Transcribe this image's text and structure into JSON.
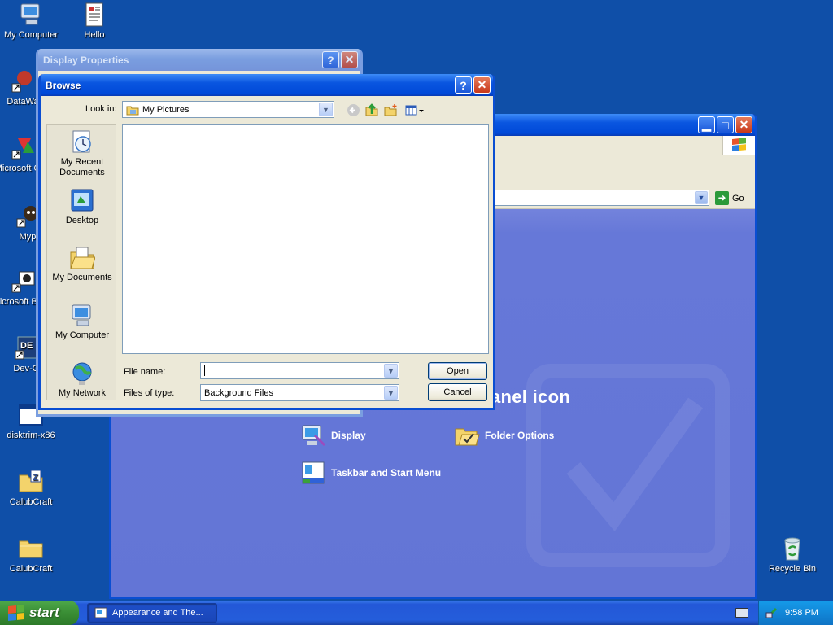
{
  "desktop": {
    "icons": [
      {
        "label": "My Computer",
        "icon": "computer-icon"
      },
      {
        "label": "Hello",
        "icon": "document-icon"
      },
      {
        "label": "DataWa",
        "icon": "shortcut-icon"
      },
      {
        "label": "Microsoft C++",
        "icon": "shortcut-icon"
      },
      {
        "label": "Myp",
        "icon": "shortcut-icon"
      },
      {
        "label": "Microsoft Basic",
        "icon": "shortcut-icon"
      },
      {
        "label": "Dev-C",
        "icon": "shortcut-icon"
      },
      {
        "label": "disktrim-x86",
        "icon": "app-icon"
      },
      {
        "label": "CalubCraft",
        "icon": "zip-folder-icon"
      },
      {
        "label": "CalubCraft",
        "icon": "folder-icon"
      },
      {
        "label": "Recycle Bin",
        "icon": "recycle-bin-icon"
      }
    ]
  },
  "control_panel": {
    "go_label": "Go",
    "heading": "anel icon",
    "items": [
      {
        "label": "Display",
        "icon": "display-icon"
      },
      {
        "label": "Folder Options",
        "icon": "folder-options-icon"
      },
      {
        "label": "Taskbar and Start Menu",
        "icon": "taskbar-icon"
      }
    ]
  },
  "display_properties": {
    "title": "Display Properties"
  },
  "browse": {
    "title": "Browse",
    "look_in_label": "Look in:",
    "look_in_value": "My Pictures",
    "places": [
      {
        "label": "My Recent Documents",
        "icon": "recent-documents-icon"
      },
      {
        "label": "Desktop",
        "icon": "desktop-icon"
      },
      {
        "label": "My Documents",
        "icon": "my-documents-icon"
      },
      {
        "label": "My Computer",
        "icon": "computer-icon"
      },
      {
        "label": "My Network",
        "icon": "network-icon"
      }
    ],
    "file_name_label": "File name:",
    "file_name_value": "",
    "file_type_label": "Files of type:",
    "file_type_value": "Background Files",
    "open_label": "Open",
    "cancel_label": "Cancel"
  },
  "taskbar": {
    "start_label": "start",
    "task_label": "Appearance and The...",
    "clock": "9:58 PM"
  },
  "colors": {
    "desktop": "#0f4fa8",
    "titlebar": "#0a56e0",
    "control_panel_bg": "#6375d6",
    "start": "#3a8e35"
  }
}
